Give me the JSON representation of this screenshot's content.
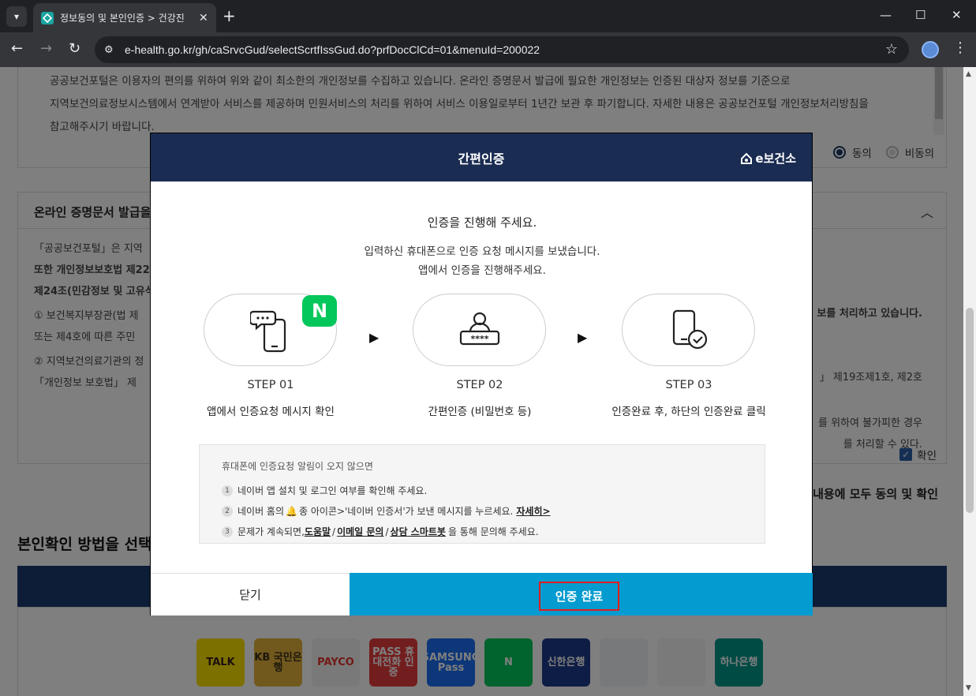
{
  "browser": {
    "tab_title": "정보동의 및 본인인증 > 건강진",
    "url": "e-health.go.kr/gh/caSrvcGud/selectScrtfIssGud.do?prfDocClCd=01&menuId=200022"
  },
  "page": {
    "box1_lines": [
      "공공보건포털은 이용자의 편의를 위하여 위와 같이 최소한의 개인정보를 수집하고 있습니다. 온라인 증명문서 발급에 필요한 개인정보는 인증된 대상자 정보를 기준으로",
      "지역보건의료정보시스템에서 연계받아 서비스를 제공하며 민원서비스의 처리를 위하여 서비스 이용일로부터 1년간 보관 후 파기합니다. 자세한 내용은 공공보건포털 개인정보처리방침을",
      "참고해주시기 바랍니다."
    ],
    "agree_label": "동의",
    "disagree_label": "비동의",
    "box2_title": "온라인 증명문서 발급을",
    "box2_lines": [
      "「공공보건포털」은 지역",
      "또한 개인정보보호법 제22",
      "제24조(민감정보 및 고유식",
      "① 보건복지부장관(법 제",
      "   또는 제4호에 따른 주민",
      "② 지역보건의료기관의 정",
      "   「개인정보 보호법」 제"
    ],
    "box2_right_lines": [
      "보를 처리하고 있습니다.",
      "」 제19조제1호, 제2호",
      "를 위하여 불가피한 경우",
      "를 처리할 수 있다."
    ],
    "confirm_label": "확인",
    "all_agree_text": "내용에 모두 동의 및 확인",
    "select_heading": "본인확인 방법을 선택",
    "apps": [
      {
        "label": "TALK",
        "color": "#f9e000",
        "text_color": "#3c1e1e"
      },
      {
        "label": "KB 국민은행",
        "color": "#e2b33b",
        "text_color": "#3a2f1a"
      },
      {
        "label": "PAYCO",
        "color": "#f2f2f2",
        "text_color": "#e4332c"
      },
      {
        "label": "PASS 휴대전화 인증",
        "color": "#e73c3c",
        "text_color": "#ffffff"
      },
      {
        "label": "SAMSUNG Pass",
        "color": "#1a6ef0",
        "text_color": "#ffffff"
      },
      {
        "label": "N",
        "color": "#03c75a",
        "text_color": "#ffffff"
      },
      {
        "label": "신한은행",
        "color": "#1d3a8a",
        "text_color": "#ffffff"
      },
      {
        "label": "",
        "color": "#eef2f7",
        "text_color": "#1a75d2"
      },
      {
        "label": "",
        "color": "#f5f5f5",
        "text_color": "#14a8c7"
      },
      {
        "label": "하나은행",
        "color": "#009688",
        "text_color": "#ffffff"
      }
    ]
  },
  "modal": {
    "title": "간편인증",
    "logo": "e보건소",
    "line1": "인증을 진행해 주세요.",
    "line2": "입력하신 휴대폰으로 인증 요청 메시지를 보냈습니다.",
    "line3": "앱에서 인증을 진행해주세요.",
    "steps": [
      {
        "name": "STEP 01",
        "desc": "앱에서 인증요청 메시지 확인"
      },
      {
        "name": "STEP 02",
        "desc": "간편인증 (비밀번호 등)"
      },
      {
        "name": "STEP 03",
        "desc": "인증완료 후, 하단의 인증완료 클릭"
      }
    ],
    "naver_badge": "N",
    "pin_text": "****",
    "help_title": "휴대폰에 인증요청 알림이 오지 않으면",
    "help1": "네이버 앱 설치 및 로그인 여부를 확인해 주세요.",
    "help2_pre": "네이버 홈의",
    "help2_mid": "종 아이콘>'네이버 인증서'가 보낸 메시지를 누르세요.",
    "help2_link": "자세히>",
    "help3_pre": "문제가 계속되면,",
    "help3_link1": "도움말",
    "help3_sep1": "/",
    "help3_link2": "이메일 문의",
    "help3_sep2": "/",
    "help3_link3": "상담 스마트봇",
    "help3_post": "을 통해 문의해 주세요.",
    "close_label": "닫기",
    "done_label": "인증 완료"
  }
}
